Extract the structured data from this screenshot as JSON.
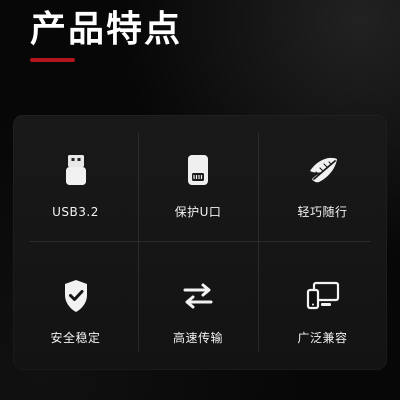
{
  "page": {
    "title": "产品特点"
  },
  "features": [
    {
      "label": "USB3.2",
      "icon": "usb-connector-icon"
    },
    {
      "label": "保护U口",
      "icon": "protected-usb-port-icon"
    },
    {
      "label": "轻巧随行",
      "icon": "feather-icon"
    },
    {
      "label": "安全稳定",
      "icon": "shield-check-icon"
    },
    {
      "label": "高速传输",
      "icon": "transfer-arrows-icon"
    },
    {
      "label": "广泛兼容",
      "icon": "devices-icon"
    }
  ],
  "colors": {
    "background": "#070707",
    "accent": "#b2151c",
    "panel": "#161616",
    "text": "#f2f2f2"
  }
}
